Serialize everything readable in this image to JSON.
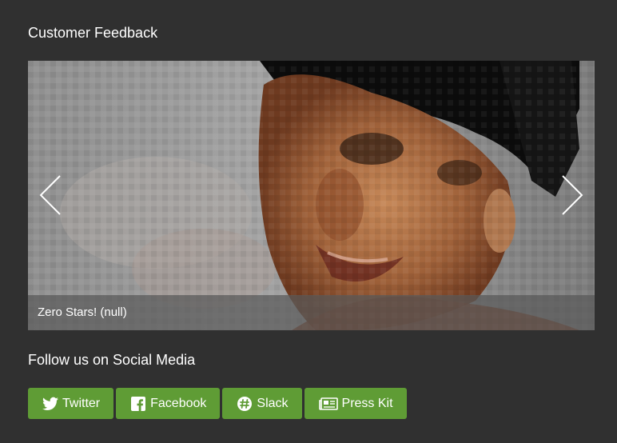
{
  "feedback": {
    "title": "Customer Feedback",
    "carousel": {
      "caption": "Zero Stars! (null)",
      "prev_icon": "chevron-left-icon",
      "next_icon": "chevron-right-icon",
      "image": "pixelated-portrait-photo"
    }
  },
  "social": {
    "title": "Follow us on Social Media",
    "buttons": [
      {
        "label": "Twitter",
        "icon": "twitter-bird-icon"
      },
      {
        "label": "Facebook",
        "icon": "facebook-icon"
      },
      {
        "label": "Slack",
        "icon": "slack-icon"
      },
      {
        "label": "Press Kit",
        "icon": "newspaper-icon"
      }
    ],
    "button_color": "#5f9c35"
  },
  "colors": {
    "background": "#303030",
    "caption_bar": "#5a5a5a"
  }
}
